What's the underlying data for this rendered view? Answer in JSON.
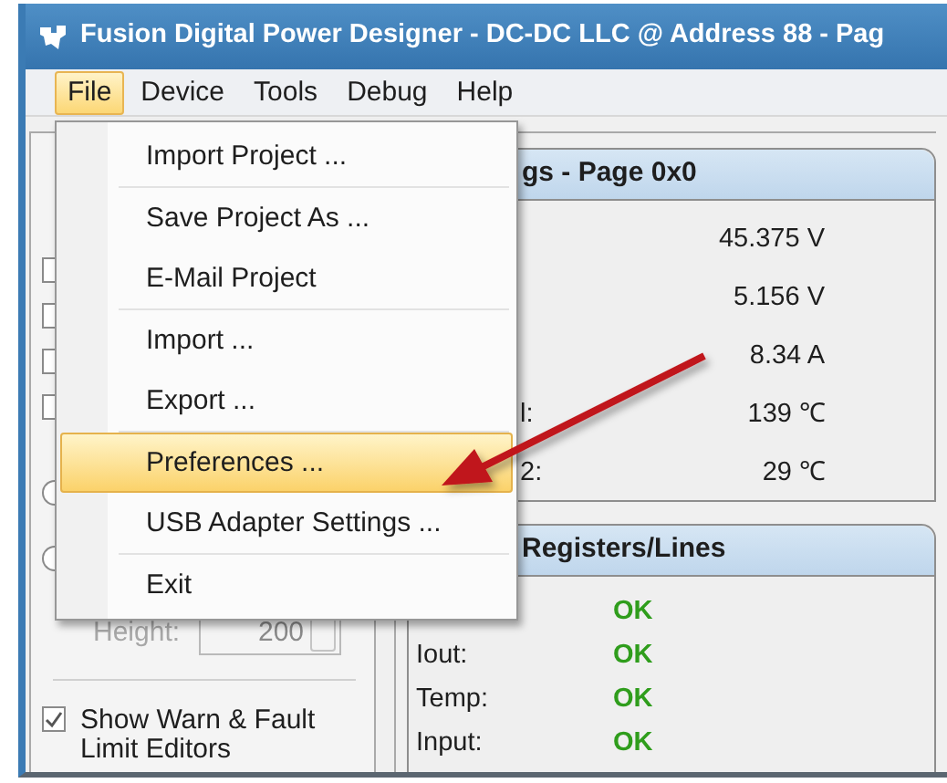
{
  "window": {
    "title": "Fusion Digital Power Designer - DC-DC LLC @ Address 88 - Pag"
  },
  "menu_bar": [
    {
      "label": "File",
      "selected": true
    },
    {
      "label": "Device",
      "selected": false
    },
    {
      "label": "Tools",
      "selected": false
    },
    {
      "label": "Debug",
      "selected": false
    },
    {
      "label": "Help",
      "selected": false
    }
  ],
  "file_menu": [
    {
      "kind": "item",
      "label": "Import Project ...",
      "selected": false
    },
    {
      "kind": "separator"
    },
    {
      "kind": "item",
      "label": "Save Project As ...",
      "selected": false
    },
    {
      "kind": "item",
      "label": "E-Mail Project",
      "selected": false
    },
    {
      "kind": "separator"
    },
    {
      "kind": "item",
      "label": "Import ...",
      "selected": false
    },
    {
      "kind": "item",
      "label": "Export ...",
      "selected": false
    },
    {
      "kind": "separator"
    },
    {
      "kind": "item",
      "label": "Preferences ...",
      "selected": true
    },
    {
      "kind": "item",
      "label": "USB Adapter Settings ...",
      "selected": false
    },
    {
      "kind": "separator"
    },
    {
      "kind": "item",
      "label": "Exit",
      "selected": false
    }
  ],
  "left_panel": {
    "controls": [
      {
        "kind": "checkbox"
      },
      {
        "kind": "checkbox"
      },
      {
        "kind": "checkbox"
      },
      {
        "kind": "checkbox"
      },
      {
        "kind": "radio"
      },
      {
        "kind": "radio"
      }
    ],
    "height": {
      "label": "Height:",
      "value": "200",
      "disabled": true
    },
    "warn_checkbox": {
      "label": "Show Warn & Fault Limit Editors",
      "checked": true
    }
  },
  "readings_group": {
    "title": "gs - Page 0x0",
    "rows": [
      {
        "value": "45.375 V"
      },
      {
        "value": "5.156 V"
      },
      {
        "value": "8.34 A"
      },
      {
        "label": "l:",
        "value": "139 ℃"
      },
      {
        "label": "2:",
        "value": "29 ℃"
      }
    ]
  },
  "status_group": {
    "title": "Registers/Lines",
    "rows": [
      {
        "status": "OK"
      },
      {
        "label": "Iout:",
        "status": "OK"
      },
      {
        "label": "Temp:",
        "status": "OK"
      },
      {
        "label": "Input:",
        "status": "OK"
      }
    ]
  }
}
